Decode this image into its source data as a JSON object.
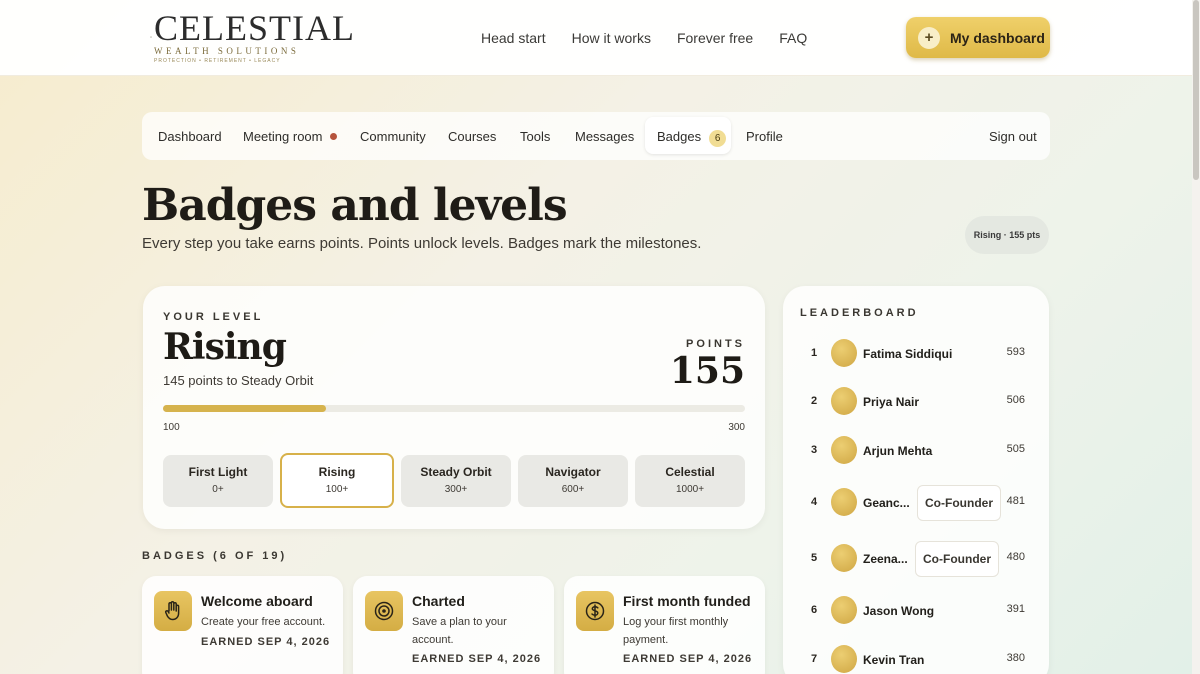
{
  "brand": {
    "name": "CELESTIAL",
    "subtitle": "WEALTH SOLUTIONS",
    "tagline": "PROTECTION • RETIREMENT • LEGACY"
  },
  "top_nav": [
    "Head start",
    "How it works",
    "Forever free",
    "FAQ"
  ],
  "dashboard_button": "My dashboard",
  "sub_nav": {
    "items": [
      "Dashboard",
      "Meeting room",
      "Community",
      "Courses",
      "Tools",
      "Messages",
      "Badges",
      "Profile"
    ],
    "badges_count": "6",
    "sign_out": "Sign out"
  },
  "page": {
    "title": "Badges and levels",
    "tagline": "Every step you take earns points. Points unlock levels. Badges mark the milestones.",
    "status_pill": "Rising · 155 pts"
  },
  "level": {
    "eyebrow": "YOUR LEVEL",
    "name": "Rising",
    "to_next": "145 points to Steady Orbit",
    "points_label": "POINTS",
    "points": "155",
    "progress": 0.28,
    "range_min": "100",
    "range_max": "300",
    "tiers": [
      {
        "name": "First Light",
        "points": "0+"
      },
      {
        "name": "Rising",
        "points": "100+"
      },
      {
        "name": "Steady Orbit",
        "points": "300+"
      },
      {
        "name": "Navigator",
        "points": "600+"
      },
      {
        "name": "Celestial",
        "points": "1000+"
      }
    ]
  },
  "badges": {
    "heading": "BADGES (6 OF 19)",
    "items": [
      {
        "icon": "hand-icon",
        "title": "Welcome aboard",
        "desc": "Create your free account.",
        "earned": "EARNED SEP 4, 2026"
      },
      {
        "icon": "target-icon",
        "title": "Charted",
        "desc": "Save a plan to your account.",
        "earned": "EARNED SEP 4, 2026"
      },
      {
        "icon": "dollar-icon",
        "title": "First month funded",
        "desc": "Log your first monthly payment.",
        "earned": "EARNED SEP 4, 2026"
      }
    ]
  },
  "leaderboard": {
    "heading": "LEADERBOARD",
    "rows": [
      {
        "rank": "1",
        "name": "Fatima Siddiqui",
        "tag": "",
        "points": "593"
      },
      {
        "rank": "2",
        "name": "Priya Nair",
        "tag": "",
        "points": "506"
      },
      {
        "rank": "3",
        "name": "Arjun Mehta",
        "tag": "",
        "points": "505"
      },
      {
        "rank": "4",
        "name": "Geanc...",
        "tag": "Co-Founder",
        "points": "481"
      },
      {
        "rank": "5",
        "name": "Zeena...",
        "tag": "Co-Founder",
        "points": "480"
      },
      {
        "rank": "6",
        "name": "Jason Wong",
        "tag": "",
        "points": "391"
      },
      {
        "rank": "7",
        "name": "Kevin Tran",
        "tag": "",
        "points": "380"
      }
    ]
  },
  "colors": {
    "accent": "#d6b34d",
    "accent_light": "#f1dd94",
    "notification_dot": "#b5533c"
  }
}
